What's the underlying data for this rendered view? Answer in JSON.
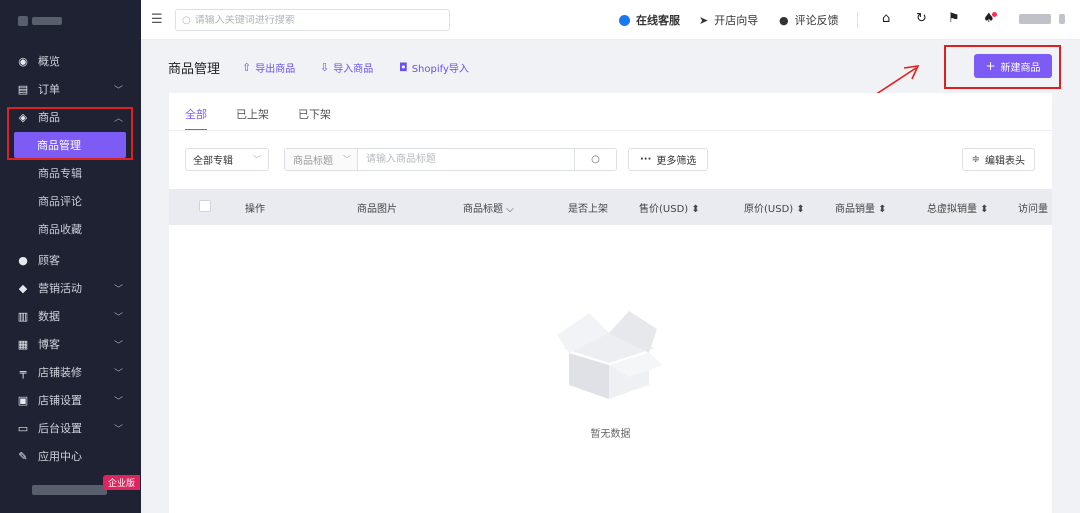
{
  "sidebar": {
    "items": [
      {
        "label": "概览",
        "icon": "dashboard-icon",
        "has_chevron": false
      },
      {
        "label": "订单",
        "icon": "order-icon",
        "has_chevron": true
      },
      {
        "label": "商品",
        "icon": "product-icon",
        "has_chevron": true,
        "expanded": true
      },
      {
        "label": "顾客",
        "icon": "customer-icon",
        "has_chevron": false
      },
      {
        "label": "营销活动",
        "icon": "tag-icon",
        "has_chevron": true
      },
      {
        "label": "数据",
        "icon": "chart-icon",
        "has_chevron": true
      },
      {
        "label": "博客",
        "icon": "blog-icon",
        "has_chevron": true
      },
      {
        "label": "店铺装修",
        "icon": "paint-icon",
        "has_chevron": true
      },
      {
        "label": "店铺设置",
        "icon": "settings-icon",
        "has_chevron": true
      },
      {
        "label": "后台设置",
        "icon": "monitor-icon",
        "has_chevron": true
      },
      {
        "label": "应用中心",
        "icon": "wrench-icon",
        "has_chevron": false
      }
    ],
    "sub_items": [
      "商品管理",
      "商品专辑",
      "商品评论",
      "商品收藏"
    ],
    "active_sub": "商品管理",
    "enterprise_tag": "企业版"
  },
  "topbar": {
    "search_placeholder": "请输入关键词进行搜索",
    "links": [
      {
        "label": "在线客服",
        "icon": "chat-bubble-icon"
      },
      {
        "label": "开店向导",
        "icon": "send-icon"
      },
      {
        "label": "评论反馈",
        "icon": "comment-icon"
      }
    ],
    "icons": [
      "home-icon",
      "refresh-icon",
      "flag-icon",
      "bell-icon"
    ]
  },
  "header": {
    "title": "商品管理",
    "export_label": "导出商品",
    "import_label": "导入商品",
    "shopify_label": "Shopify导入",
    "new_button_label": "新建商品"
  },
  "tabs": [
    "全部",
    "已上架",
    "已下架"
  ],
  "filters": {
    "collection_select": "全部专辑",
    "field_select": "商品标题",
    "search_placeholder": "请输入商品标题",
    "more_filters": "更多筛选",
    "edit_header": "编辑表头"
  },
  "table": {
    "columns": [
      "操作",
      "商品图片",
      "商品标题 ⌵",
      "是否上架",
      "售价(USD) ⬍",
      "原价(USD) ⬍",
      "商品销量 ⬍",
      "总虚拟销量 ⬍",
      "访问量"
    ]
  },
  "empty_text": "暂无数据",
  "colors": {
    "sidebar_bg": "#1e2233",
    "accent": "#7c5cf5",
    "annotation_red": "#e02020"
  }
}
